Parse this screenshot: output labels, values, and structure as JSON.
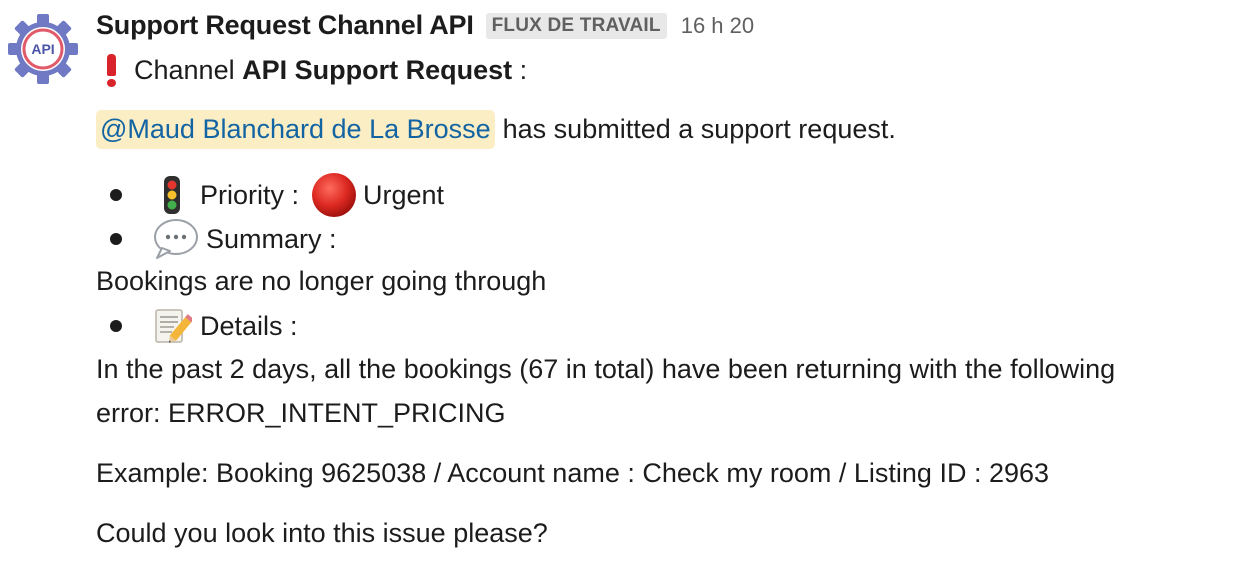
{
  "message": {
    "sender": "Support Request Channel API",
    "badge": "FLUX DE TRAVAIL",
    "timestamp": "16 h 20",
    "avatar_text": "API",
    "avatar_icon": "gear-icon",
    "title_prefix": "Channel",
    "title_bold": "API Support Request",
    "title_suffix": ":",
    "mention": "@Maud Blanchard de La Brosse",
    "submitted_text": "has submitted a support request.",
    "priority": {
      "icon": "traffic-light-icon",
      "label": "Priority :",
      "value_icon": "red-circle-icon",
      "value": "Urgent"
    },
    "summary": {
      "icon": "speech-balloon-icon",
      "label": "Summary :",
      "text": "Bookings are no longer going through"
    },
    "details": {
      "icon": "memo-icon",
      "label": "Details :",
      "line1": "In the past 2 days, all the bookings (67 in total) have been returning with the following",
      "line2": "error: ERROR_INTENT_PRICING"
    },
    "example": "Example: Booking 9625038 / Account name : Check my room / Listing ID : 2963",
    "closing": "Could you look into this issue please?"
  }
}
